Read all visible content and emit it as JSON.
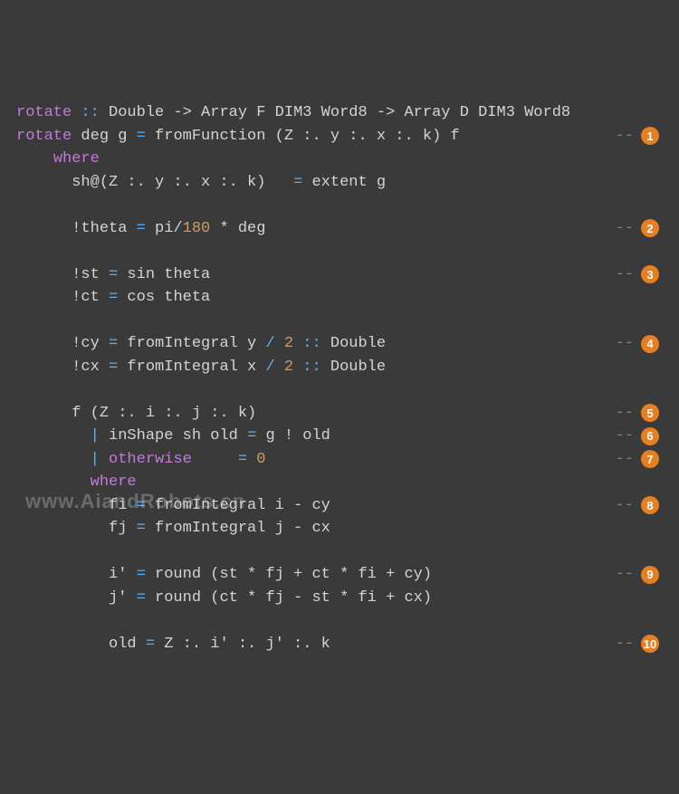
{
  "lines": [
    {
      "t": "rotate :: Double -> Array F DIM3 Word8 -> Array D DIM3 Word8",
      "badge": null
    },
    {
      "t": "rotate deg g = fromFunction (Z :. y :. x :. k) f",
      "badge": "1"
    },
    {
      "t": "    where",
      "badge": null
    },
    {
      "t": "      sh@(Z :. y :. x :. k)   = extent g",
      "badge": null
    },
    {
      "t": "",
      "badge": null
    },
    {
      "t": "      !theta = pi/180 * deg",
      "badge": "2"
    },
    {
      "t": "",
      "badge": null
    },
    {
      "t": "      !st = sin theta",
      "badge": "3"
    },
    {
      "t": "      !ct = cos theta",
      "badge": null
    },
    {
      "t": "",
      "badge": null
    },
    {
      "t": "      !cy = fromIntegral y / 2 :: Double",
      "badge": "4"
    },
    {
      "t": "      !cx = fromIntegral x / 2 :: Double",
      "badge": null
    },
    {
      "t": "",
      "badge": null
    },
    {
      "t": "      f (Z :. i :. j :. k)",
      "badge": "5"
    },
    {
      "t": "        | inShape sh old = g ! old",
      "badge": "6"
    },
    {
      "t": "        | otherwise     = 0",
      "badge": "7"
    },
    {
      "t": "        where",
      "badge": null
    },
    {
      "t": "          fi = fromIntegral i - cy",
      "badge": "8"
    },
    {
      "t": "          fj = fromIntegral j - cx",
      "badge": null
    },
    {
      "t": "",
      "badge": null
    },
    {
      "t": "          i' = round (st * fj + ct * fi + cy)",
      "badge": "9"
    },
    {
      "t": "          j' = round (ct * fj - st * fi + cx)",
      "badge": null
    },
    {
      "t": "",
      "badge": null
    },
    {
      "t": "          old = Z :. i' :. j' :. k",
      "badge": "10"
    }
  ],
  "watermark": "www.AiandRobots.cn",
  "dashes": "--"
}
